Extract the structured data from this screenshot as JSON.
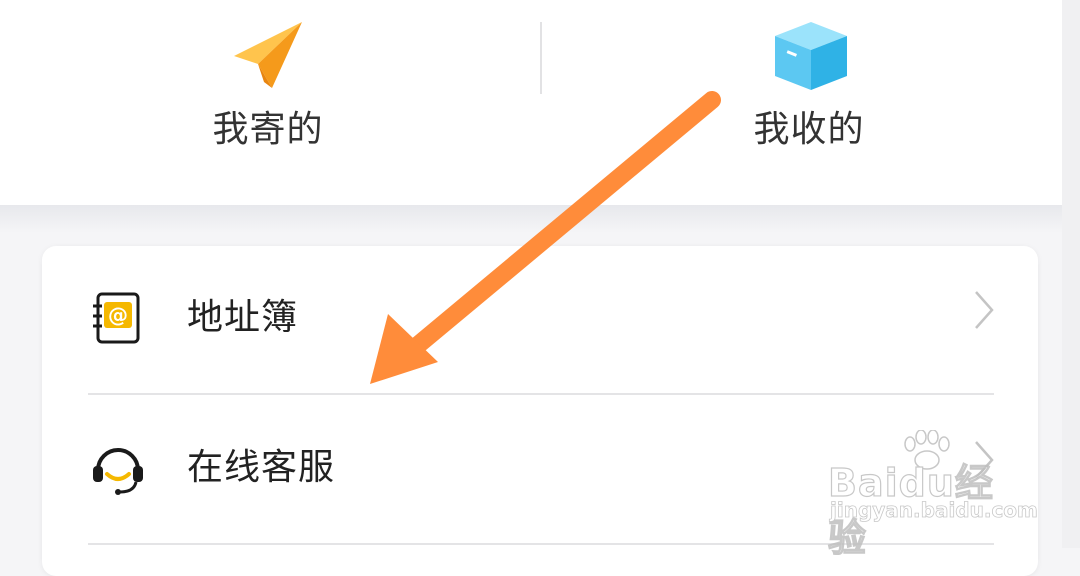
{
  "quick_actions": {
    "sent": {
      "label": "我寄的",
      "icon": "paper-plane-icon"
    },
    "received": {
      "label": "我收的",
      "icon": "package-box-icon"
    }
  },
  "menu": {
    "items": [
      {
        "label": "地址簿",
        "icon": "address-book-icon"
      },
      {
        "label": "在线客服",
        "icon": "headset-icon"
      }
    ]
  },
  "watermark": {
    "brand_left": "Bai",
    "brand_mid": "du",
    "brand_right": "经验",
    "url": "jingyan.baidu.com"
  },
  "colors": {
    "accent_orange": "#ff8c3a",
    "plane_orange": "#f9a825",
    "box_blue": "#4fc3f7",
    "icon_yellow": "#f5b800"
  }
}
